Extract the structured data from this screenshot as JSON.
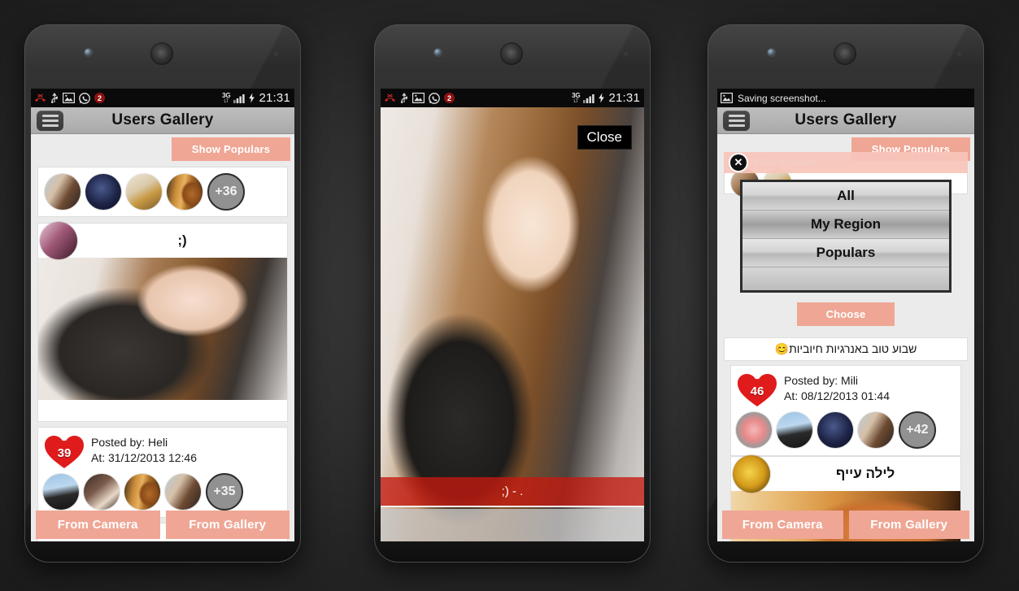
{
  "app": {
    "title": "Users Gallery",
    "show_populars_label": "Show Populars",
    "from_camera_label": "From Camera",
    "from_gallery_label": "From Gallery",
    "menu_icon": "hamburger-menu-icon"
  },
  "statusbar": {
    "time": "21:31",
    "network_type": "3G",
    "network_sub": "LT",
    "notification_count": "2",
    "icons": [
      "missed-call-icon",
      "usb-icon",
      "image-icon",
      "whatsapp-icon",
      "notification-badge"
    ],
    "signal_icon": "signal-bars-icon",
    "battery_icon": "battery-charging-icon",
    "saving_text": "Saving screenshot..."
  },
  "phone1": {
    "populars_strip": {
      "avatars": [
        "avatar-woman-blue",
        "avatar-dark-blue",
        "avatar-child",
        "avatar-night-portrait"
      ],
      "more_count": "+36"
    },
    "post": {
      "title": ";)",
      "avatar": "avatar-purple-girl",
      "photo": "photo-selfie-woman"
    },
    "meta": {
      "likes": "39",
      "posted_by": "Posted by: Heli",
      "posted_at": "At: 31/12/2013 12:46",
      "avatars": [
        "avatar-hands",
        "avatar-dark-girl",
        "avatar-night-portrait",
        "avatar-woman-blue"
      ],
      "more_count": "+35"
    }
  },
  "phone2": {
    "close_label": "Close",
    "caption": ";) - .",
    "photo": "photo-selfie-woman-fullscreen"
  },
  "phone3": {
    "dialog": {
      "title": "Filter Options",
      "close_icon": "close-circle-icon",
      "options": [
        "All",
        "My Region",
        "Populars"
      ],
      "selected_option": "My Region",
      "choose_label": "Choose"
    },
    "hebrew_caption": "שבוע טוב באנרגיות חיוביות😊",
    "meta": {
      "likes": "46",
      "posted_by": "Posted by: Mili",
      "posted_at": "At: 08/12/2013 01:44",
      "avatars": [
        "avatar-red-heart",
        "avatar-hands",
        "avatar-dark-blue",
        "avatar-woman-blue"
      ],
      "more_count": "+42"
    },
    "post2": {
      "title": "לילה עייף",
      "avatar": "avatar-yellow-bird",
      "photo": "photo-dog"
    }
  },
  "colors": {
    "accent_salmon": "#efa694",
    "appbar_gray": "#b2b2b2",
    "heart_red": "#e01b1b",
    "caption_red": "#c41a10",
    "page_bg": "#ebebeb"
  }
}
